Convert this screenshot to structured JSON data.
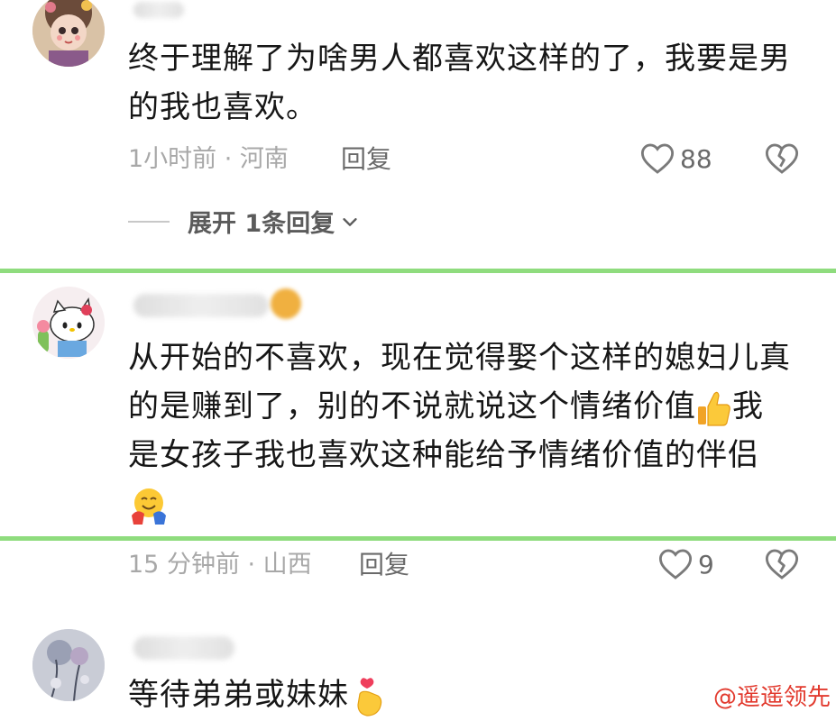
{
  "comments": [
    {
      "text": "终于理解了为啥男人都喜欢这样的了，我要是男的我也喜欢。",
      "meta": "1小时前 · 河南",
      "reply_label": "回复",
      "likes": "88",
      "expand_label": "展开 1条回复"
    },
    {
      "text_line1": "从开始的不喜欢，现在觉得娶个这样的媳妇儿真",
      "text_line2a": "的是赚到了，别的不说就说这个情绪价值",
      "text_line2b": "我",
      "text_line3": "是女孩子我也喜欢这种能给予情绪价值的伴侣",
      "meta": "15 分钟前 · 山西",
      "reply_label": "回复",
      "likes": "9"
    },
    {
      "text": "等待弟弟或妹妹"
    }
  ],
  "icons": {
    "like": "heart-outline-icon",
    "dislike": "broken-heart-icon",
    "expand": "chevron-down-icon",
    "thumbs_up": "thumbs-up-emoji",
    "hug": "hugging-face-emoji",
    "finger_heart": "finger-heart-emoji"
  },
  "colors": {
    "highlight_border": "#8fdc7e",
    "watermark": "#e23a2e"
  },
  "watermark": "@遥遥领先"
}
